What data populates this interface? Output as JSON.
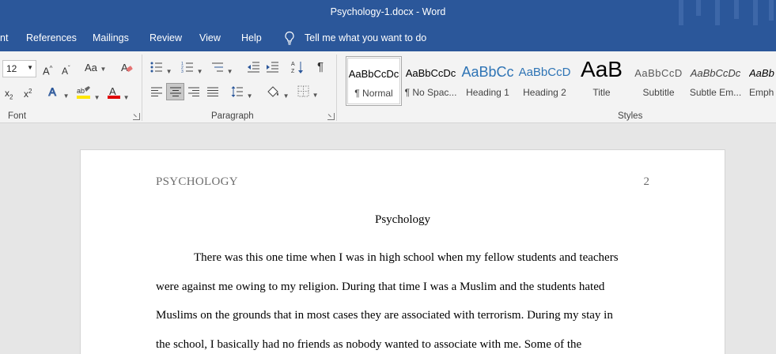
{
  "window": {
    "title": "Psychology-1.docx  -  Word"
  },
  "tabs": {
    "partial_first": "nt",
    "items": [
      "References",
      "Mailings",
      "Review",
      "View",
      "Help"
    ],
    "tell_me": "Tell me what you want to do"
  },
  "ribbon": {
    "font_size": "12",
    "change_case_label": "Aa",
    "groups": {
      "font": "Font",
      "paragraph": "Paragraph",
      "styles": "Styles"
    },
    "styles": [
      {
        "preview": "AaBbCcDc",
        "name": "¶ Normal",
        "selected": true
      },
      {
        "preview": "AaBbCcDc",
        "name": "¶ No Spac..."
      },
      {
        "preview": "AaBbCc",
        "name": "Heading 1"
      },
      {
        "preview": "AaBbCcD",
        "name": "Heading 2"
      },
      {
        "preview": "AaB",
        "name": "Title"
      },
      {
        "preview": "AaBbCcD",
        "name": "Subtitle"
      },
      {
        "preview": "AaBbCcDc",
        "name": "Subtle Em..."
      },
      {
        "preview": "AaBb",
        "name": "Emph"
      }
    ]
  },
  "document": {
    "running_head": "PSYCHOLOGY",
    "page_number": "2",
    "title": "Psychology",
    "lines": [
      "There was this one time when I was in high school when my fellow students and teachers",
      "were against me owing to my religion. During that time I was a Muslim and the students hated",
      "Muslims on the grounds that in most cases they are associated with terrorism. During my stay in",
      "the school, I basically had no friends as nobody wanted to associate with me. Some of the"
    ]
  },
  "colors": {
    "accent": "#2b579a",
    "ribbon": "#f3f3f3",
    "canvas": "#e6e6e6"
  }
}
